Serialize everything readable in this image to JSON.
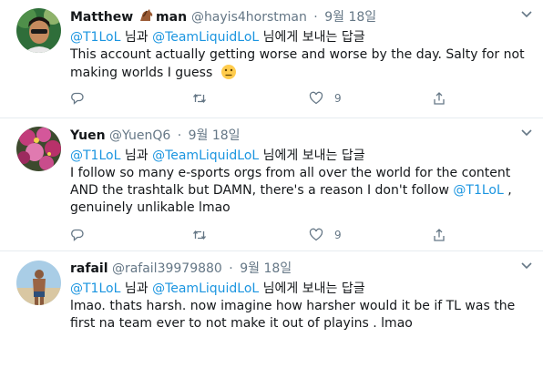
{
  "tweets": [
    {
      "name_part1": "Matthew",
      "name_part2": "man",
      "horse_emoji": "horse-emoji",
      "handle": "@hayis4horstman",
      "sep": "·",
      "date": "9월 18일",
      "reply_mention_1": "@T1LoL",
      "reply_and": "님과",
      "reply_mention_2": "@TeamLiquidLoL",
      "reply_suffix": "님에게 보내는 답글",
      "body_line1": "This account actually getting worse and worse by the day. Salty for not",
      "body_line2": "making worlds I guess",
      "like_count": "9"
    },
    {
      "name": "Yuen",
      "handle": "@YuenQ6",
      "sep": "·",
      "date": "9월 18일",
      "reply_mention_1": "@T1LoL",
      "reply_and": "님과",
      "reply_mention_2": "@TeamLiquidLoL",
      "reply_suffix": "님에게 보내는 답글",
      "body_line1": "I follow so many e-sports orgs from all over the world for the content",
      "body_line2": "AND the trashtalk but DAMN, there's a reason I don't follow",
      "body_line2_mention": "@T1LoL",
      "body_line2_end": ",",
      "body_line3": "genuinely unlikable lmao",
      "like_count": "9"
    },
    {
      "name": "rafail",
      "handle": "@rafail39979880",
      "sep": "·",
      "date": "9월 18일",
      "reply_mention_1": "@T1LoL",
      "reply_and": "님과",
      "reply_mention_2": "@TeamLiquidLoL",
      "reply_suffix": "님에게 보내는 답글",
      "body_line1": "lmao. thats harsh. now imagine how harsher would it be if TL was the",
      "body_line2": "first na team ever to not make it out of playins . lmao"
    }
  ],
  "colors": {
    "link": "#1b95e0",
    "muted": "#657786",
    "divider": "#e6ecf0"
  }
}
